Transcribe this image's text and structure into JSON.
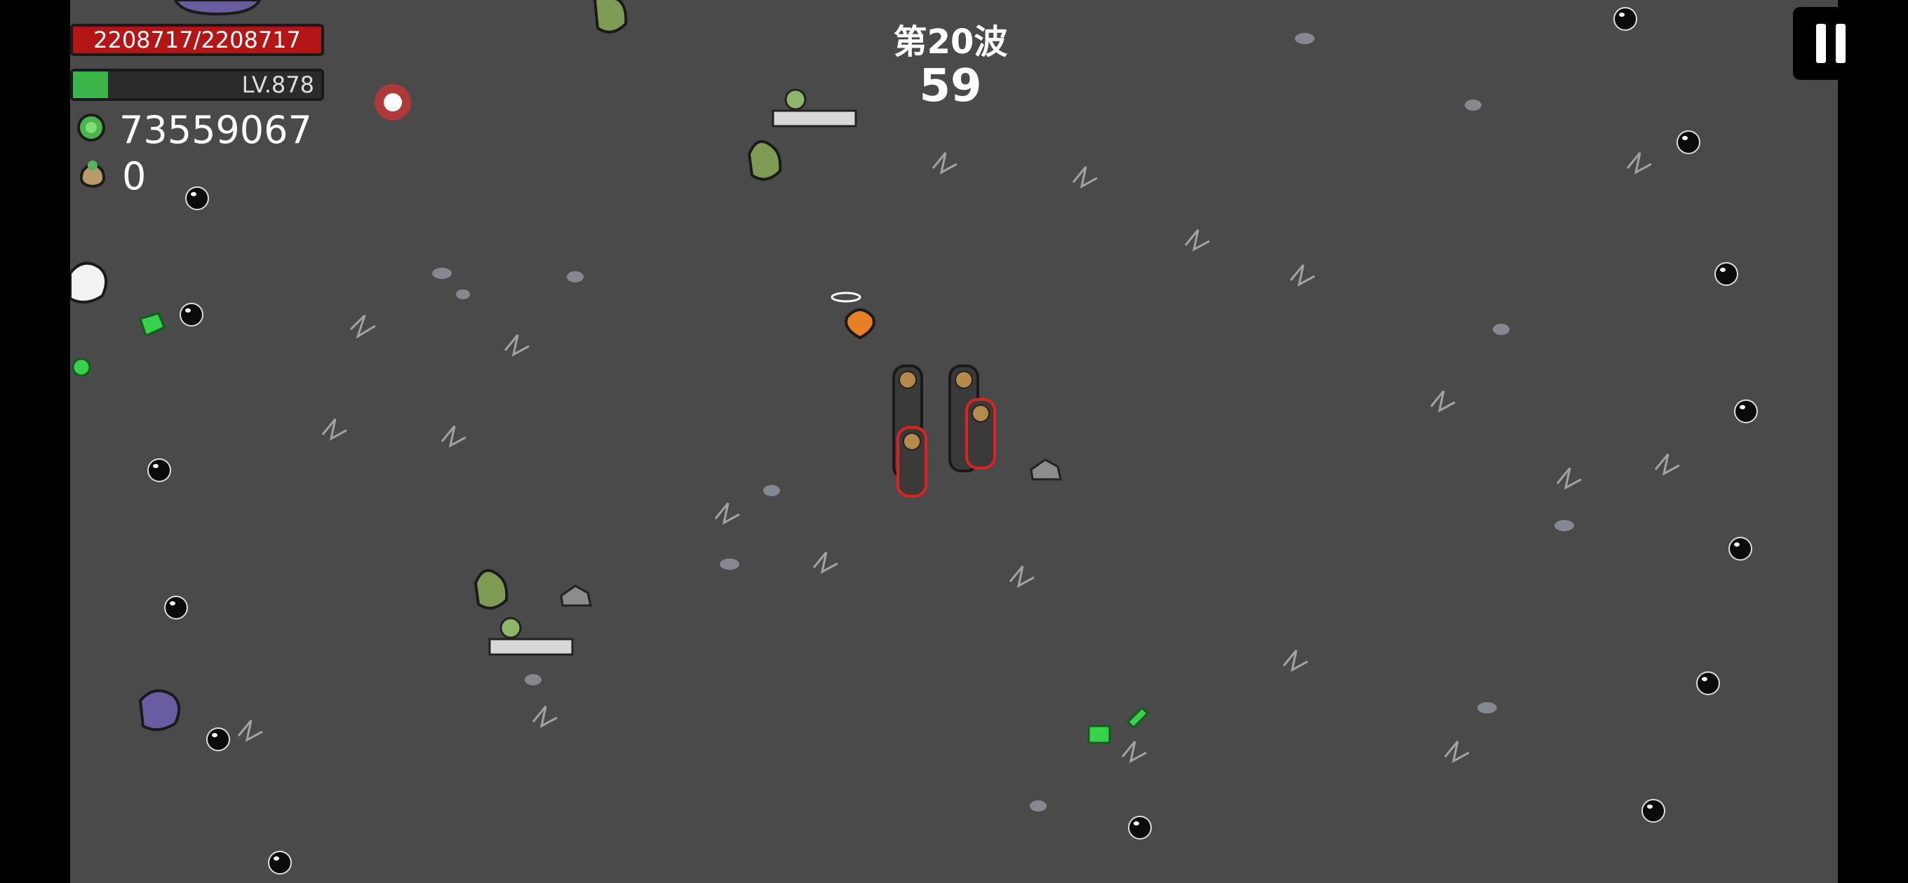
{
  "hud": {
    "health_text": "2208717/2208717",
    "health_fraction": 1.0,
    "level_text": "LV.878",
    "xp_fraction": 0.14,
    "coins": "73559067",
    "bags": "0",
    "wave_label": "第20波",
    "timer": "59"
  },
  "icons": {
    "coin": "green-coin-icon",
    "bag": "money-bag-icon",
    "pause": "pause-icon"
  },
  "colors": {
    "health": "#b41515",
    "xp": "#3bb54a",
    "arena": "#4a4a4a",
    "background": "#000000"
  }
}
